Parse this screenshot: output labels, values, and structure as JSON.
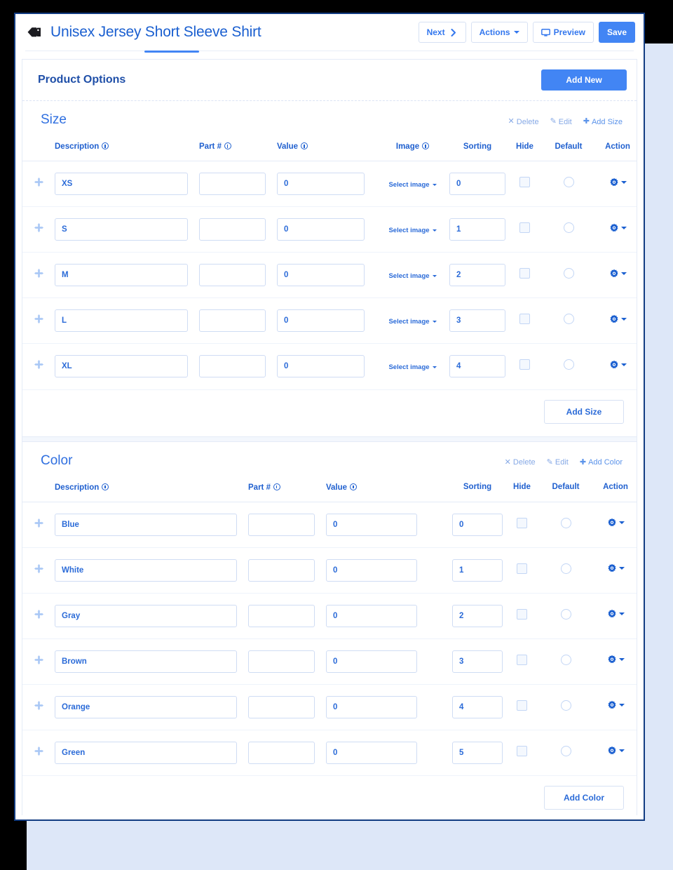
{
  "header": {
    "title": "Unisex Jersey Short Sleeve Shirt",
    "tag_icon": "tag-icon",
    "buttons": {
      "next": "Next",
      "actions": "Actions",
      "preview": "Preview",
      "save": "Save"
    }
  },
  "panel": {
    "title": "Product Options",
    "add_new": "Add New"
  },
  "colors": {
    "accent": "#4285f4",
    "title_blue": "#1a5fd0",
    "link_blue": "#2b6bd8",
    "muted_link": "#86a9e6",
    "border": "#cfdcf4",
    "window_border": "#123c82",
    "shadow_panel": "#dde7f8"
  },
  "groups": [
    {
      "name": "Size",
      "links": {
        "delete": "Delete",
        "edit": "Edit",
        "add": "Add Size"
      },
      "footer_button": "Add Size",
      "has_image_column": true,
      "columns": {
        "description": "Description",
        "part": "Part #",
        "value": "Value",
        "image": "Image",
        "sorting": "Sorting",
        "hide": "Hide",
        "default": "Default",
        "action": "Action"
      },
      "image_placeholder": "Select image",
      "rows": [
        {
          "description": "XS",
          "part": "",
          "value": "0",
          "image": "Select image",
          "sorting": "0",
          "hide": false,
          "default": false
        },
        {
          "description": "S",
          "part": "",
          "value": "0",
          "image": "Select image",
          "sorting": "1",
          "hide": false,
          "default": false
        },
        {
          "description": "M",
          "part": "",
          "value": "0",
          "image": "Select image",
          "sorting": "2",
          "hide": false,
          "default": false
        },
        {
          "description": "L",
          "part": "",
          "value": "0",
          "image": "Select image",
          "sorting": "3",
          "hide": false,
          "default": false
        },
        {
          "description": "XL",
          "part": "",
          "value": "0",
          "image": "Select image",
          "sorting": "4",
          "hide": false,
          "default": false
        }
      ]
    },
    {
      "name": "Color",
      "links": {
        "delete": "Delete",
        "edit": "Edit",
        "add": "Add Color"
      },
      "footer_button": "Add Color",
      "has_image_column": false,
      "columns": {
        "description": "Description",
        "part": "Part #",
        "value": "Value",
        "sorting": "Sorting",
        "hide": "Hide",
        "default": "Default",
        "action": "Action"
      },
      "rows": [
        {
          "description": "Blue",
          "part": "",
          "value": "0",
          "sorting": "0",
          "hide": false,
          "default": false
        },
        {
          "description": "White",
          "part": "",
          "value": "0",
          "sorting": "1",
          "hide": false,
          "default": false
        },
        {
          "description": "Gray",
          "part": "",
          "value": "0",
          "sorting": "2",
          "hide": false,
          "default": false
        },
        {
          "description": "Brown",
          "part": "",
          "value": "0",
          "sorting": "3",
          "hide": false,
          "default": false
        },
        {
          "description": "Orange",
          "part": "",
          "value": "0",
          "sorting": "4",
          "hide": false,
          "default": false
        },
        {
          "description": "Green",
          "part": "",
          "value": "0",
          "sorting": "5",
          "hide": false,
          "default": false
        }
      ]
    }
  ]
}
